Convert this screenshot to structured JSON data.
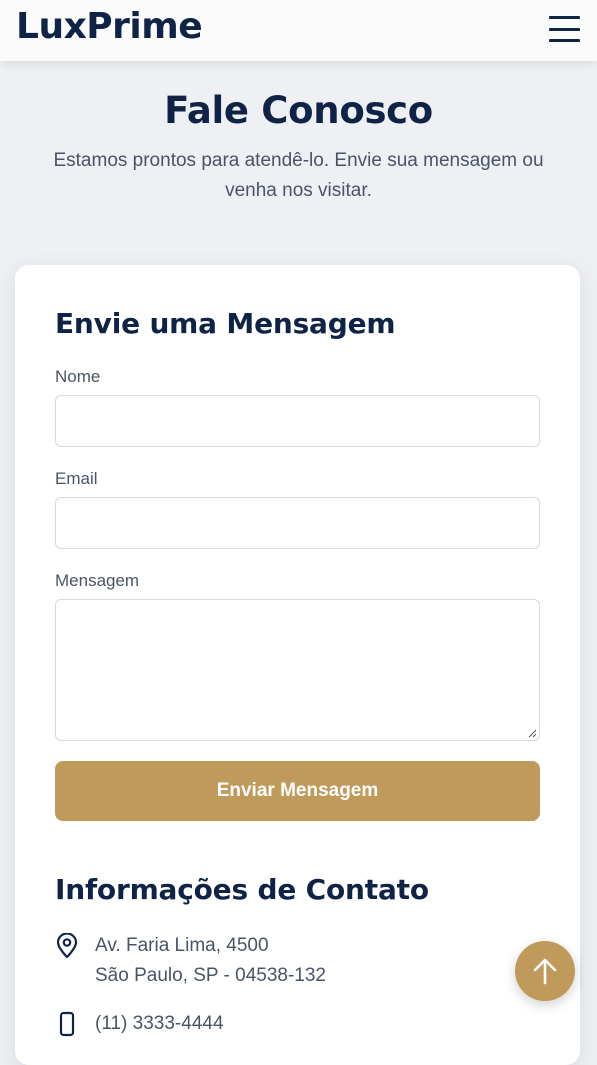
{
  "header": {
    "logo": "LuxPrime",
    "menu_icon": "hamburger-menu-icon"
  },
  "hero": {
    "title": "Fale Conosco",
    "subtitle_line1": "Estamos prontos para atendê-lo. Envie sua mensagem ou",
    "subtitle_line2": "venha nos visitar."
  },
  "form": {
    "title": "Envie uma Mensagem",
    "name_label": "Nome",
    "name_value": "",
    "email_label": "Email",
    "email_value": "",
    "message_label": "Mensagem",
    "message_value": "",
    "submit_label": "Enviar Mensagem"
  },
  "contact": {
    "title": "Informações de Contato",
    "address_line1": "Av. Faria Lima, 4500",
    "address_line2": "São Paulo, SP - 04538-132",
    "phone": "(11) 3333-4444",
    "address_icon": "map-pin-icon",
    "phone_icon": "phone-icon"
  },
  "colors": {
    "navy": "#0f2347",
    "gold": "#bf9a5a",
    "background": "#eef0f4",
    "muted_text": "#4a5466"
  },
  "scroll_top_icon": "arrow-up-icon"
}
